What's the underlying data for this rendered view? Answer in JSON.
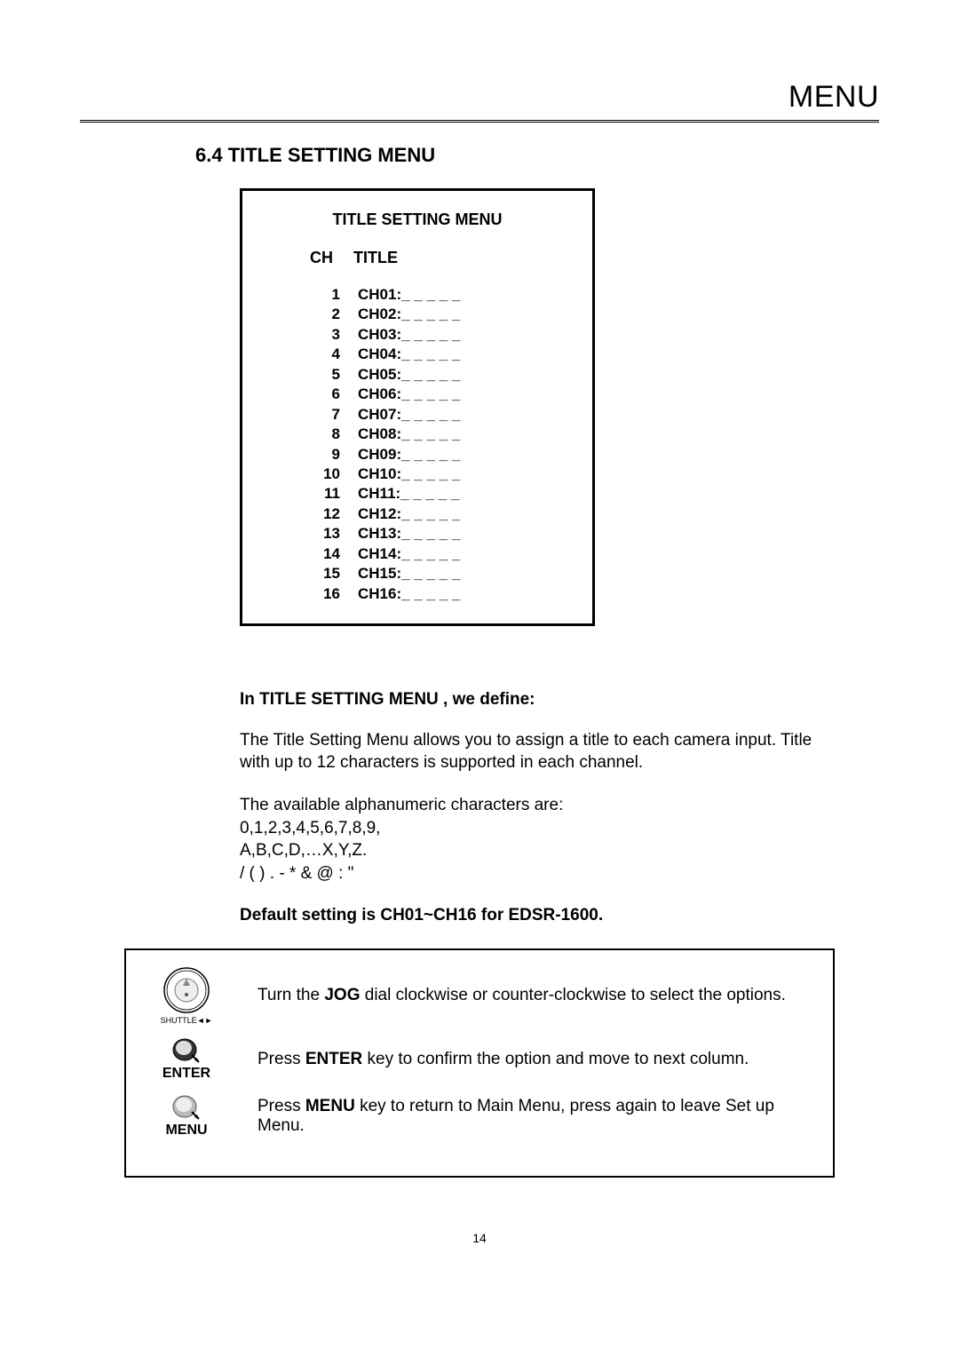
{
  "header": {
    "title": "MENU"
  },
  "section": {
    "title": "6.4 TITLE SETTING MENU"
  },
  "menu_box": {
    "title": "TITLE SETTING MENU",
    "col_ch": "CH",
    "col_title": "TITLE",
    "rows": [
      {
        "n": "1",
        "t": "CH01:_ _ _ _ _"
      },
      {
        "n": "2",
        "t": "CH02:_ _ _ _ _"
      },
      {
        "n": "3",
        "t": "CH03:_ _ _ _ _"
      },
      {
        "n": "4",
        "t": "CH04:_ _ _ _ _"
      },
      {
        "n": "5",
        "t": "CH05:_ _ _ _ _"
      },
      {
        "n": "6",
        "t": "CH06:_ _ _ _ _"
      },
      {
        "n": "7",
        "t": "CH07:_ _ _ _ _"
      },
      {
        "n": "8",
        "t": "CH08:_ _ _ _ _"
      },
      {
        "n": "9",
        "t": "CH09:_ _ _ _ _"
      },
      {
        "n": "10",
        "t": "CH10:_ _ _ _ _"
      },
      {
        "n": "11",
        "t": "CH11:_ _ _ _ _"
      },
      {
        "n": "12",
        "t": "CH12:_ _ _ _ _"
      },
      {
        "n": "13",
        "t": "CH13:_ _ _ _ _"
      },
      {
        "n": "14",
        "t": "CH14:_ _ _ _ _"
      },
      {
        "n": "15",
        "t": "CH15:_ _ _ _ _"
      },
      {
        "n": "16",
        "t": "CH16:_ _ _ _ _"
      }
    ]
  },
  "body": {
    "define_heading": "In TITLE  SETTING MENU , we define:",
    "p1": "The Title Setting Menu allows you to assign a title to each camera input. Title with up to 12 characters is supported in each channel.",
    "p2_l1": "The available alphanumeric characters are:",
    "p2_l2": "0,1,2,3,4,5,6,7,8,9,",
    "p2_l3": "A,B,C,D,…X,Y,Z.",
    "p2_l4": "/ (  ) . - * & @ : \"",
    "default": "Default setting is CH01~CH16 for EDSR-1600."
  },
  "instructions": {
    "jog_pre": "Turn the ",
    "jog_bold": "JOG",
    "jog_post": " dial clockwise or counter-clockwise to select the options.",
    "enter_pre": "Press ",
    "enter_bold": "ENTER",
    "enter_post": " key to confirm the option and move to next column.",
    "enter_label": "ENTER",
    "menu_pre": "Press ",
    "menu_bold": "MENU",
    "menu_post": " key to return to Main Menu, press again to leave Set up Menu.",
    "menu_label": "MENU",
    "jog_sub": "SHUTTLE◄►"
  },
  "page_number": "14"
}
